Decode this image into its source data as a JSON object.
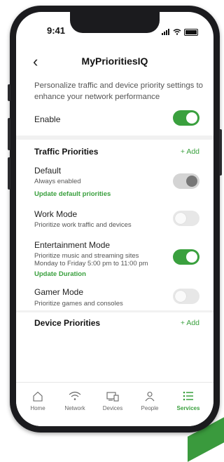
{
  "status_bar": {
    "time": "9:41"
  },
  "header": {
    "title": "MyPrioritiesIQ"
  },
  "description": "Personalize traffic and device priority settings to enhance your network performance",
  "enable": {
    "label": "Enable",
    "state": "on"
  },
  "traffic_priorities": {
    "title": "Traffic Priorities",
    "add_label": "+ Add",
    "modes": [
      {
        "name": "Default",
        "subtitle": "Always enabled",
        "link": "Update default priorities",
        "state": "on-disabled"
      },
      {
        "name": "Work Mode",
        "subtitle": "Prioritize work traffic and devices",
        "state": "off"
      },
      {
        "name": "Entertainment Mode",
        "subtitle": "Prioritize music and streaming sites",
        "subtitle2": "Monday to Friday 5:00 pm to 11:00 pm",
        "link": "Update Duration",
        "state": "on"
      },
      {
        "name": "Gamer Mode",
        "subtitle": "Prioritize games and consoles",
        "state": "off"
      }
    ]
  },
  "device_priorities": {
    "title": "Device Priorities",
    "add_label": "+ Add"
  },
  "tabs": [
    {
      "label": "Home",
      "icon": "home-icon"
    },
    {
      "label": "Network",
      "icon": "wifi-icon"
    },
    {
      "label": "Devices",
      "icon": "devices-icon"
    },
    {
      "label": "People",
      "icon": "people-icon"
    },
    {
      "label": "Services",
      "icon": "services-icon",
      "active": true
    }
  ],
  "colors": {
    "accent": "#3aa03e",
    "toggle_off": "#e7e7e7",
    "toggle_disabled_knob": "#777777"
  }
}
